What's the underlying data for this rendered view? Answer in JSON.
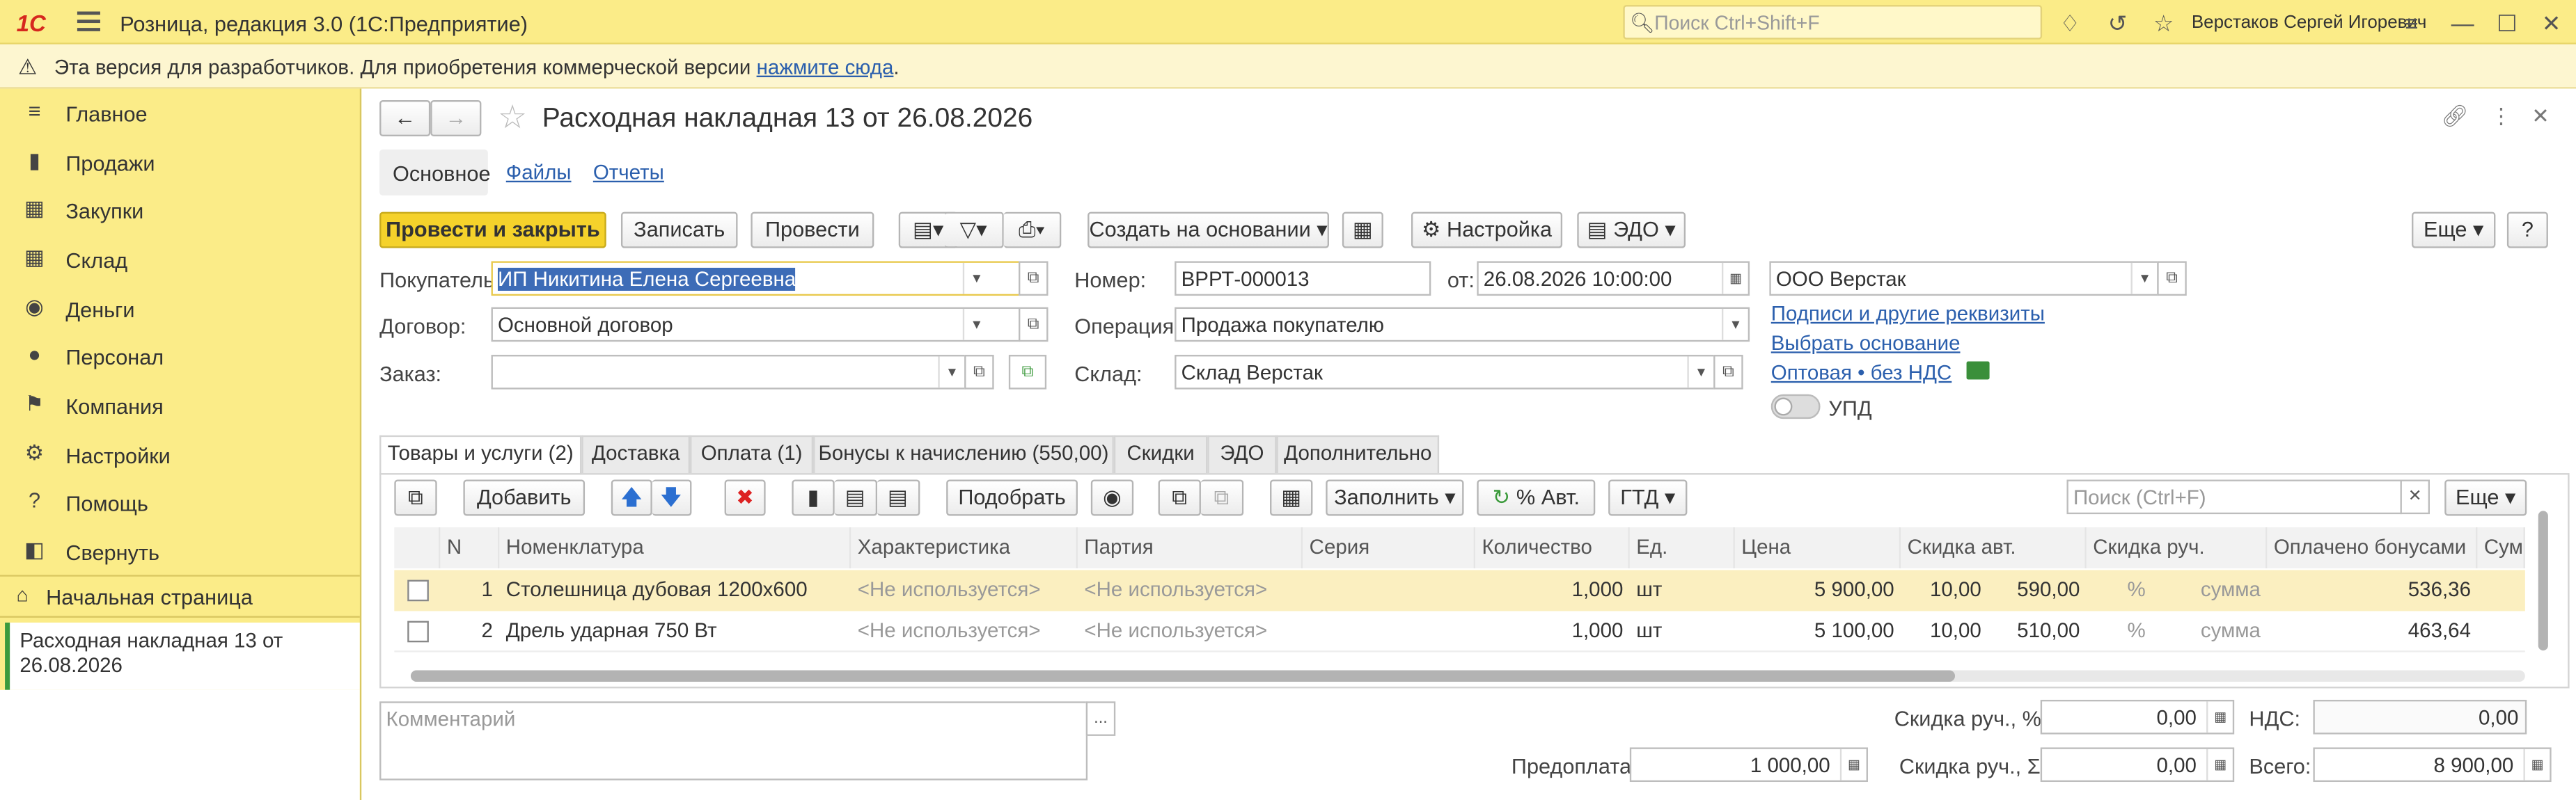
{
  "app": {
    "logo": "1С",
    "title": "Розница, редакция 3.0  (1С:Предприятие)",
    "search_placeholder": "Поиск Ctrl+Shift+F",
    "user": "Верстаков Сергей Игоревич"
  },
  "warning": {
    "text": "Эта версия для разработчиков. Для приобретения коммерческой версии ",
    "link": "нажмите сюда",
    "suffix": "."
  },
  "sidebar": {
    "items": [
      {
        "label": "Главное",
        "icon": "menu-icon"
      },
      {
        "label": "Продажи",
        "icon": "cart-icon"
      },
      {
        "label": "Закупки",
        "icon": "purchase-icon"
      },
      {
        "label": "Склад",
        "icon": "warehouse-icon"
      },
      {
        "label": "Деньги",
        "icon": "money-icon"
      },
      {
        "label": "Персонал",
        "icon": "people-icon"
      },
      {
        "label": "Компания",
        "icon": "flag-icon"
      },
      {
        "label": "Настройки",
        "icon": "gear-icon"
      },
      {
        "label": "Помощь",
        "icon": "help-icon"
      },
      {
        "label": "Свернуть",
        "icon": "collapse-icon"
      }
    ],
    "home": "Начальная страница",
    "open_doc": "Расходная накладная 13 от 26.08.2026"
  },
  "doc": {
    "title": "Расходная накладная 13 от 26.08.2026",
    "tabs": [
      "Основное",
      "Файлы",
      "Отчеты"
    ]
  },
  "toolbar": {
    "post_close": "Провести и закрыть",
    "save": "Записать",
    "post": "Провести",
    "create_based": "Создать на основании",
    "settings": "Настройка",
    "edo": "ЭДО",
    "more": "Еще",
    "help": "?"
  },
  "form": {
    "buyer_label": "Покупатель:",
    "buyer": "ИП Никитина Елена Сергеевна",
    "contract_label": "Договор:",
    "contract": "Основной договор",
    "order_label": "Заказ:",
    "order": "",
    "number_label": "Номер:",
    "number": "ВРРТ-000013",
    "from_label": "от:",
    "date": "26.08.2026 10:00:00",
    "operation_label": "Операция:",
    "operation": "Продажа покупателю",
    "warehouse_label": "Склад:",
    "warehouse": "Склад Верстак",
    "org": "ООО Верстак",
    "link_signatures": "Подписи и другие реквизиты",
    "link_basis": "Выбрать основание",
    "link_vat": "Оптовая • без НДС",
    "upd": "УПД"
  },
  "tabs": [
    "Товары и услуги (2)",
    "Доставка",
    "Оплата (1)",
    "Бонусы к начислению (550,00)",
    "Скидки",
    "ЭДО",
    "Дополнительно"
  ],
  "table_toolbar": {
    "add": "Добавить",
    "pick": "Подобрать",
    "fill": "Заполнить",
    "auto_pct": "% Авт.",
    "gtd": "ГТД",
    "search_placeholder": "Поиск (Ctrl+F)",
    "more": "Еще"
  },
  "table": {
    "headers": [
      "N",
      "Номенклатура",
      "Характеристика",
      "Партия",
      "Серия",
      "Количество",
      "Ед.",
      "Цена",
      "Скидка авт.",
      "Скидка руч.",
      "Оплачено бонусами",
      "Сум"
    ],
    "rows": [
      {
        "n": "1",
        "name": "Столешница дубовая 1200х600",
        "char": "<Не используется>",
        "batch": "<Не используется>",
        "series": "",
        "qty": "1,000",
        "unit": "шт",
        "price": "5 900,00",
        "disc_pct": "10,00",
        "disc_sum": "590,00",
        "man_pct": "%",
        "man_sum": "сумма",
        "bonus": "536,36"
      },
      {
        "n": "2",
        "name": "Дрель ударная 750 Вт",
        "char": "<Не используется>",
        "batch": "<Не используется>",
        "series": "",
        "qty": "1,000",
        "unit": "шт",
        "price": "5 100,00",
        "disc_pct": "10,00",
        "disc_sum": "510,00",
        "man_pct": "%",
        "man_sum": "сумма",
        "bonus": "463,64"
      }
    ]
  },
  "footer": {
    "comment_placeholder": "Комментарий",
    "prepay_label": "Предоплата:",
    "prepay": "1 000,00",
    "disc_pct_label": "Скидка руч., %:",
    "disc_pct": "0,00",
    "disc_sum_label": "Скидка руч., Σ:",
    "disc_sum": "0,00",
    "vat_label": "НДС:",
    "vat": "0,00",
    "total_label": "Всего:",
    "total": "8 900,00"
  }
}
